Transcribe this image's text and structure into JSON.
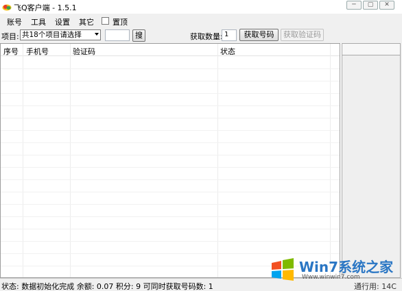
{
  "window": {
    "title": "飞Q客户端 - 1.5.1",
    "controls": [
      "minimize",
      "restore",
      "close"
    ]
  },
  "menu": {
    "items": [
      "账号",
      "工具",
      "设置",
      "其它"
    ],
    "topmost_label": "置顶",
    "topmost_checked": false
  },
  "toolbar": {
    "project_label": "项目:",
    "project_select": "共18个项目请选择",
    "search_value": "",
    "search_button": "搜",
    "fetch_count_label": "获取数量:",
    "fetch_count_value": "1",
    "get_number_button": "获取号码",
    "get_code_button": "获取验证码"
  },
  "grid": {
    "columns": [
      "序号",
      "手机号",
      "验证码",
      "状态"
    ],
    "rows": []
  },
  "status_bar": {
    "text": "状态: 数据初始化完成  余额: 0.07  积分: 9  可同时获取号码数: 1",
    "right_text": "通行用: 14C"
  },
  "watermark": {
    "brand": "Win7系统之家",
    "url": "Www.winwin7.com"
  },
  "colors": {
    "chrome": "#f0f0f0",
    "watermark_blue": "#2a76c4"
  }
}
